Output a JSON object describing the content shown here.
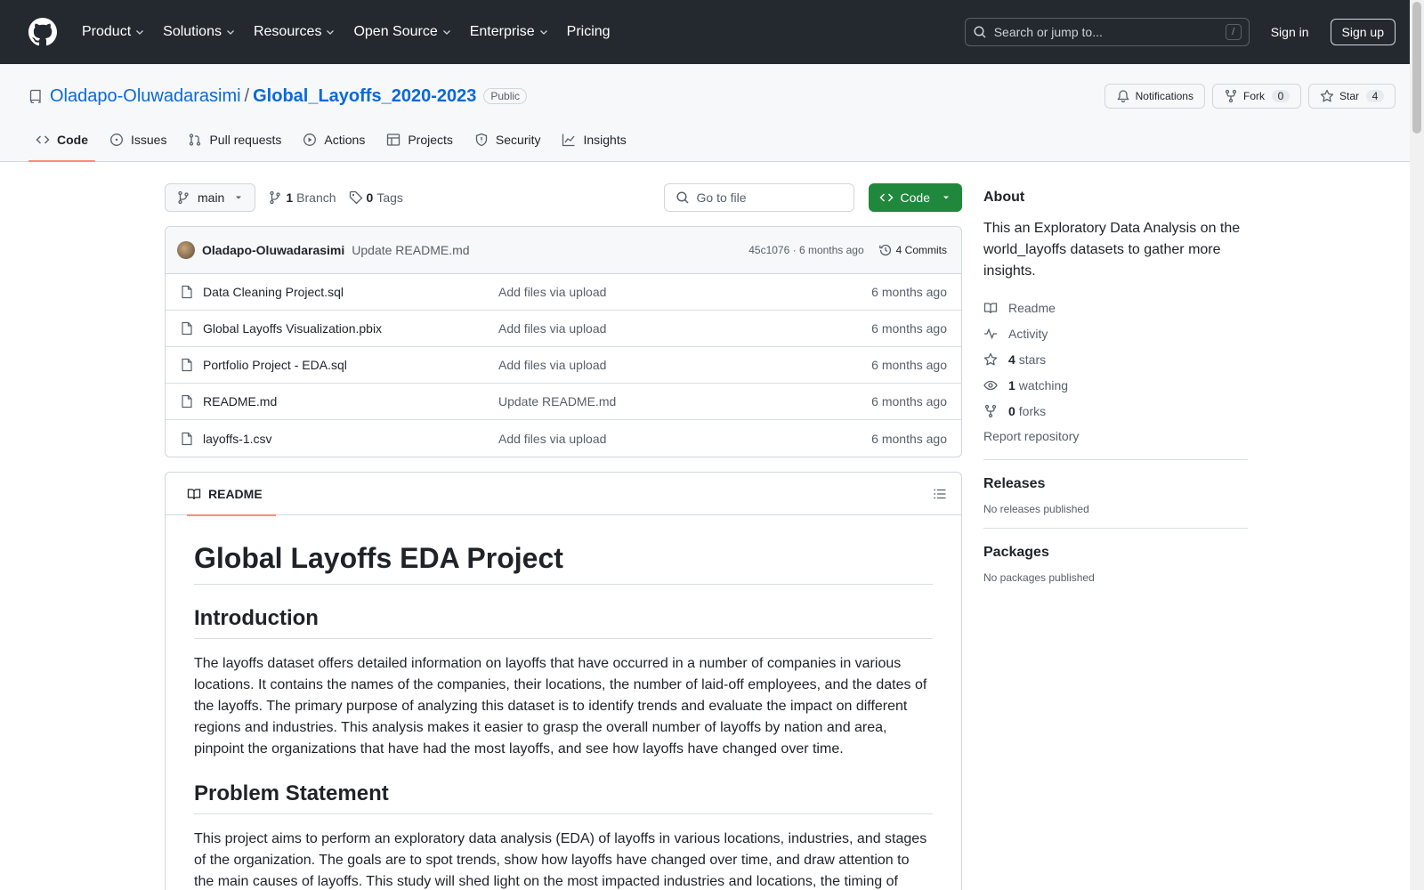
{
  "header": {
    "nav": [
      "Product",
      "Solutions",
      "Resources",
      "Open Source",
      "Enterprise",
      "Pricing"
    ],
    "search_placeholder": "Search or jump to...",
    "search_shortcut": "/",
    "signin": "Sign in",
    "signup": "Sign up"
  },
  "repo": {
    "owner": "Oladapo-Oluwadarasimi",
    "separator": "/",
    "name": "Global_Layoffs_2020-2023",
    "visibility": "Public",
    "notifications": "Notifications",
    "fork_label": "Fork",
    "fork_count": "0",
    "star_label": "Star",
    "star_count": "4",
    "tabs": [
      "Code",
      "Issues",
      "Pull requests",
      "Actions",
      "Projects",
      "Security",
      "Insights"
    ]
  },
  "filenav": {
    "branch": "main",
    "branch_count": "1",
    "branch_label": "Branch",
    "tag_count": "0",
    "tag_label": "Tags",
    "goto_placeholder": "Go to file",
    "code_button": "Code"
  },
  "commit": {
    "author": "Oladapo-Oluwadarasimi",
    "message": "Update README.md",
    "meta": "45c1076 · 6 months ago",
    "commits": "4 Commits"
  },
  "files": [
    {
      "name": "Data Cleaning Project.sql",
      "message": "Add files via upload",
      "time": "6 months ago"
    },
    {
      "name": "Global Layoffs Visualization.pbix",
      "message": "Add files via upload",
      "time": "6 months ago"
    },
    {
      "name": "Portfolio Project - EDA.sql",
      "message": "Add files via upload",
      "time": "6 months ago"
    },
    {
      "name": "README.md",
      "message": "Update README.md",
      "time": "6 months ago"
    },
    {
      "name": "layoffs-1.csv",
      "message": "Add files via upload",
      "time": "6 months ago"
    }
  ],
  "readme": {
    "tab": "README",
    "title": "Global Layoffs EDA Project",
    "h_intro": "Introduction",
    "p_intro": "The layoffs dataset offers detailed information on layoffs that have occurred in a number of companies in various locations. It contains the names of the companies, their locations, the number of laid-off employees, and the dates of the layoffs. The primary purpose of analyzing this dataset is to identify trends and evaluate the impact on different regions and industries. This analysis makes it easier to grasp the overall number of layoffs by nation and area, pinpoint the organizations that have had the most layoffs, and see how layoffs have changed over time.",
    "h_problem": "Problem Statement",
    "p_problem": "This project aims to perform an exploratory data analysis (EDA) of layoffs in various locations, industries, and stages of the organization. The goals are to spot trends, show how layoffs have changed over time, and draw attention to the main causes of layoffs. This study will shed light on the most impacted industries and locations, the timing of"
  },
  "about": {
    "title": "About",
    "description": "This an Exploratory Data Analysis on the world_layoffs datasets to gather more insights.",
    "readme": "Readme",
    "activity": "Activity",
    "stars_count": "4",
    "stars_label": "stars",
    "watching_count": "1",
    "watching_label": "watching",
    "forks_count": "0",
    "forks_label": "forks",
    "report": "Report repository"
  },
  "releases": {
    "title": "Releases",
    "empty": "No releases published"
  },
  "packages": {
    "title": "Packages",
    "empty": "No packages published"
  }
}
